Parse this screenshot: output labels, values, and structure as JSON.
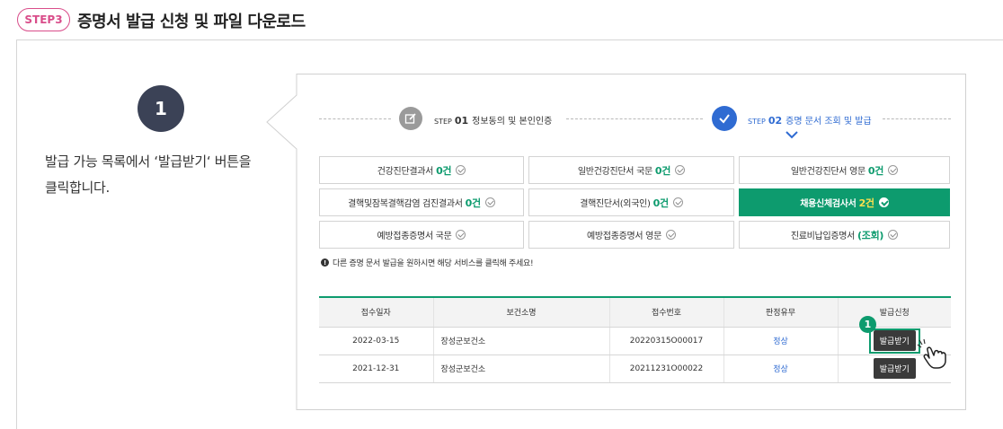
{
  "header": {
    "step_badge": "STEP3",
    "title": "증명서 발급 신청 및 파일 다운로드"
  },
  "guide": {
    "step_number": "1",
    "instruction_line1": "발급 가능 목록에서 ‘발급받기‘ 버튼을",
    "instruction_line2": "클릭합니다."
  },
  "progress": {
    "steps": [
      {
        "step": "STEP",
        "num": "01",
        "label": "정보동의 및 본인인증",
        "icon": "edit-icon",
        "state": "done"
      },
      {
        "step": "STEP",
        "num": "02",
        "label": "증명 문서 조회 및 발급",
        "icon": "check-icon",
        "state": "active"
      }
    ]
  },
  "certificates": [
    {
      "name": "건강진단결과서",
      "count": "0건",
      "selected": false
    },
    {
      "name": "일반건강진단서 국문",
      "count": "0건",
      "selected": false
    },
    {
      "name": "일반건강진단서 영문",
      "count": "0건",
      "selected": false
    },
    {
      "name": "결핵및잠복결핵감염 검진결과서",
      "count": "0건",
      "selected": false
    },
    {
      "name": "결핵진단서(외국인)",
      "count": "0건",
      "selected": false
    },
    {
      "name": "채용신체검사서",
      "count": "2건",
      "selected": true
    },
    {
      "name": "예방접종증명서 국문",
      "count": "",
      "selected": false
    },
    {
      "name": "예방접종증명서 영문",
      "count": "",
      "selected": false
    },
    {
      "name": "진료비납입증명서",
      "count": "(조회)",
      "selected": false
    }
  ],
  "notice": "다른 증명 문서 발급을 원하시면 해당 서비스를 클릭해 주세요!",
  "table": {
    "headers": [
      "접수일자",
      "보건소명",
      "접수번호",
      "판정유무",
      "발급신청"
    ],
    "rows": [
      {
        "date": "2022-03-15",
        "center": "장성군보건소",
        "receipt": "20220315O00017",
        "result": "정상",
        "action": "발급받기"
      },
      {
        "date": "2021-12-31",
        "center": "장성군보건소",
        "receipt": "20211231O00022",
        "result": "정상",
        "action": "발급받기"
      }
    ]
  },
  "marker_number": "1",
  "colors": {
    "accent_green": "#0d9b6e",
    "step_pink": "#d94d8a",
    "active_blue": "#2f6bd2",
    "dark_circle": "#3b4256"
  }
}
